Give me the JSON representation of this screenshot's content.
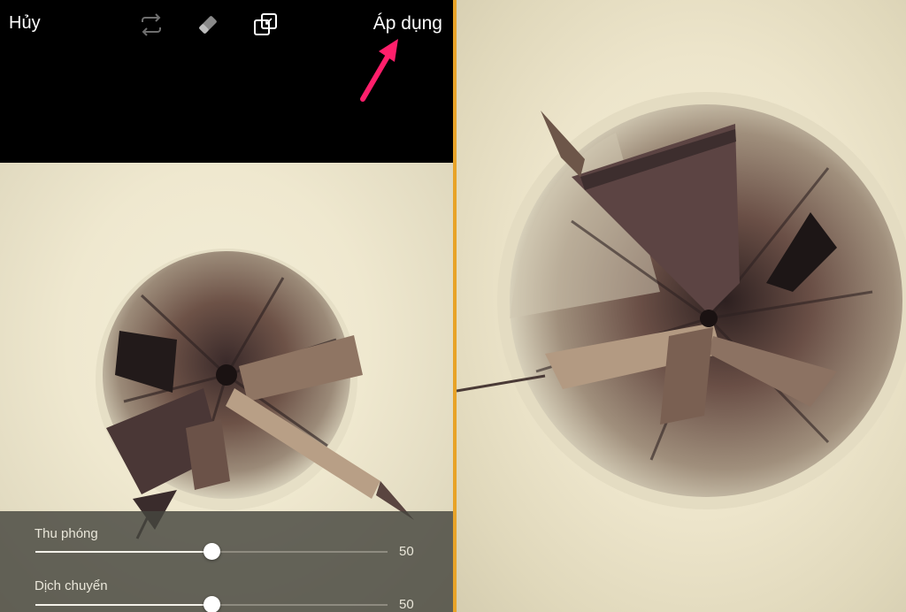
{
  "toolbar": {
    "cancel_label": "Hủy",
    "apply_label": "Áp dụng",
    "icons": [
      "repeat-icon",
      "eraser-icon",
      "compare-icon"
    ]
  },
  "controls": {
    "sliders": [
      {
        "label": "Thu phóng",
        "value": "50",
        "fraction": 0.5
      },
      {
        "label": "Dịch chuyển",
        "value": "50",
        "fraction": 0.5
      }
    ]
  },
  "colors": {
    "accent_divider": "#e8a328",
    "arrow": "#ff1f6b",
    "sepia_light": "#efe8cf",
    "building_dark": "#4a3736"
  }
}
